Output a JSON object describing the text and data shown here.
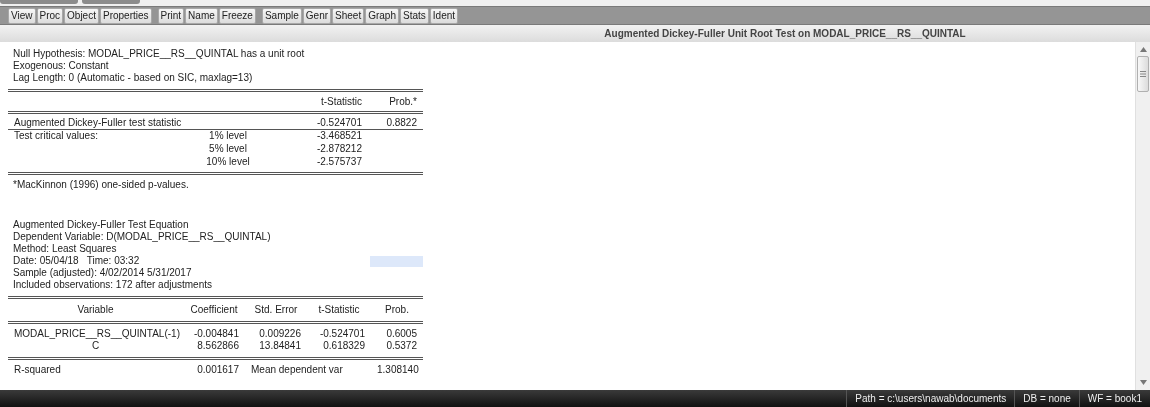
{
  "window_tabs": [
    {
      "selected": false
    },
    {
      "selected": false
    }
  ],
  "toolbar": {
    "groups": [
      {
        "buttons": [
          "View",
          "Proc",
          "Object",
          "Properties"
        ]
      },
      {
        "buttons": [
          "Print",
          "Name",
          "Freeze"
        ]
      },
      {
        "buttons": [
          "Sample",
          "Genr",
          "Sheet",
          "Graph",
          "Stats",
          "Ident"
        ]
      }
    ]
  },
  "title": "Augmented Dickey-Fuller Unit Root Test on MODAL_PRICE__RS__QUINTAL",
  "unit_root_test": {
    "header_lines": [
      "Null Hypothesis: MODAL_PRICE__RS__QUINTAL has a unit root",
      "Exogenous: Constant",
      "Lag Length: 0 (Automatic - based on SIC, maxlag=13)"
    ],
    "columns": {
      "t_statistic": "t-Statistic",
      "prob": "Prob.*"
    },
    "rows": [
      {
        "label": "Augmented Dickey-Fuller test statistic",
        "t_statistic": "-0.524701",
        "prob": "0.8822",
        "underlined": true
      },
      {
        "label": "Test critical values:",
        "significance": "1% level",
        "t_statistic": "-3.468521",
        "underlined": false
      },
      {
        "significance": "5% level",
        "t_statistic": "-2.878212",
        "underlined": false
      },
      {
        "significance": "10% level",
        "t_statistic": "-2.575737",
        "underlined": false
      }
    ],
    "footnote": "*MacKinnon (1996) one-sided p-values."
  },
  "test_equation": {
    "header_lines": [
      {
        "text": "Augmented Dickey-Fuller Test Equation",
        "highlighted": false
      },
      {
        "text": "Dependent Variable: D(MODAL_PRICE__RS__QUINTAL)",
        "highlighted": false
      },
      {
        "text": "Method: Least Squares",
        "highlighted": false
      },
      {
        "text": "Date: 05/04/18   Time: 03:32",
        "highlighted": true
      },
      {
        "text": "Sample (adjusted): 4/02/2014 5/31/2017",
        "highlighted": false
      },
      {
        "text": "Included observations: 172 after adjustments",
        "highlighted": false
      }
    ],
    "columns": [
      "Variable",
      "Coefficient",
      "Std. Error",
      "t-Statistic",
      "Prob."
    ],
    "rows": [
      {
        "variable": "MODAL_PRICE__RS__QUINTAL(-1)",
        "coefficient": "-0.004841",
        "std_error": "0.009226",
        "t_statistic": "-0.524701",
        "prob": "0.6005"
      },
      {
        "variable": "C",
        "coefficient": "8.562866",
        "std_error": "13.84841",
        "t_statistic": "0.618329",
        "prob": "0.5372"
      }
    ],
    "statistics": [
      {
        "label": "R-squared",
        "value": "0.001617",
        "label_2": "Mean dependent var",
        "value_2": "1.308140"
      }
    ]
  },
  "status_bar": [
    "Path = c:\\users\\nawab\\documents",
    "DB = none",
    "WF = book1"
  ]
}
